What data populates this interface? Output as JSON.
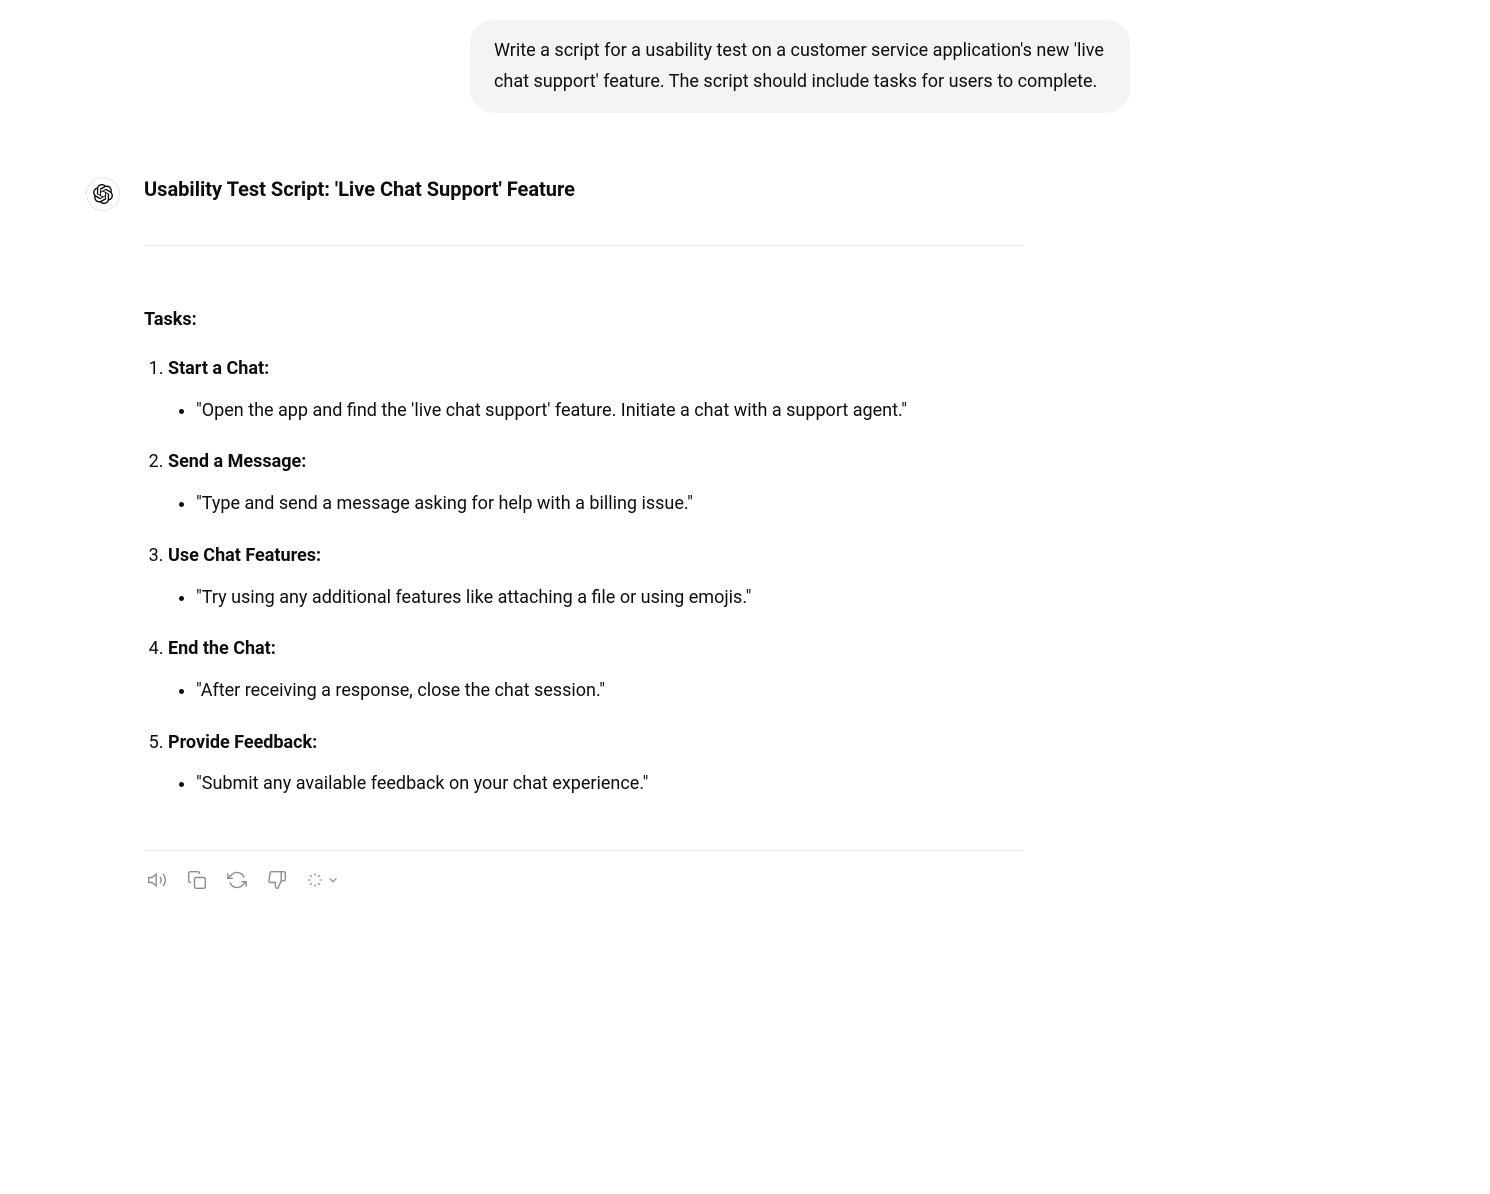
{
  "user_message": "Write a script for a usability test on a customer service application's new 'live chat support' feature. The script should include tasks for users to complete.",
  "assistant": {
    "title": "Usability Test Script: 'Live Chat Support' Feature",
    "tasks_heading": "Tasks:",
    "tasks": [
      {
        "title": "Start a Chat:",
        "detail": "\"Open the app and find the 'live chat support' feature. Initiate a chat with a support agent.\""
      },
      {
        "title": "Send a Message:",
        "detail": "\"Type and send a message asking for help with a billing issue.\""
      },
      {
        "title": "Use Chat Features:",
        "detail": "\"Try using any additional features like attaching a file or using emojis.\""
      },
      {
        "title": "End the Chat:",
        "detail": "\"After receiving a response, close the chat session.\""
      },
      {
        "title": "Provide Feedback:",
        "detail": "\"Submit any available feedback on your chat experience.\""
      }
    ]
  },
  "actions": {
    "read_aloud": "read-aloud",
    "copy": "copy",
    "regenerate": "regenerate",
    "bad": "bad-response",
    "change_model": "change-model"
  }
}
